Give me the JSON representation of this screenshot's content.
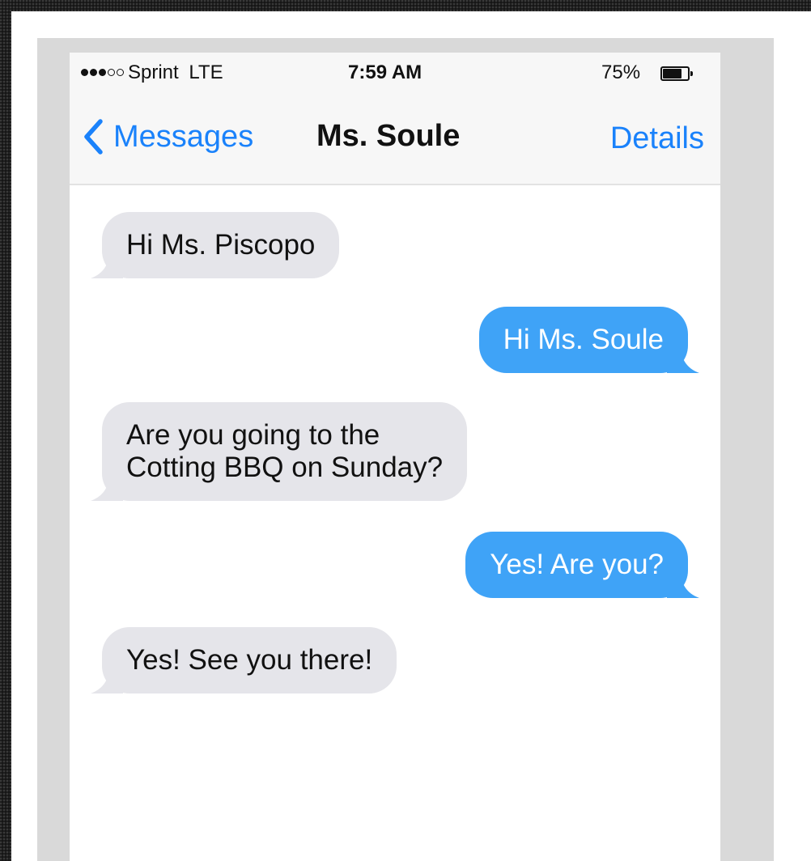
{
  "status_bar": {
    "carrier": "Sprint LTE",
    "signal_bars_filled": 3,
    "signal_bars_total": 5,
    "time": "7:59 AM",
    "battery": "75%",
    "battery_fraction": 0.75
  },
  "nav": {
    "back_label": "Messages",
    "title": "Ms. Soule",
    "details_label": "Details"
  },
  "colors": {
    "accent": "#1a82fb",
    "incoming_bubble": "#e5e5ea",
    "outgoing_bubble": "#3fa3f7"
  },
  "messages": [
    {
      "direction": "incoming",
      "text": "Hi Ms. Piscopo"
    },
    {
      "direction": "outgoing",
      "text": "Hi Ms. Soule"
    },
    {
      "direction": "incoming",
      "lines": [
        "Are you going to the",
        "Cotting BBQ on Sunday?"
      ]
    },
    {
      "direction": "outgoing",
      "text": "Yes! Are you?"
    },
    {
      "direction": "incoming",
      "text": "Yes! See you there!"
    }
  ]
}
